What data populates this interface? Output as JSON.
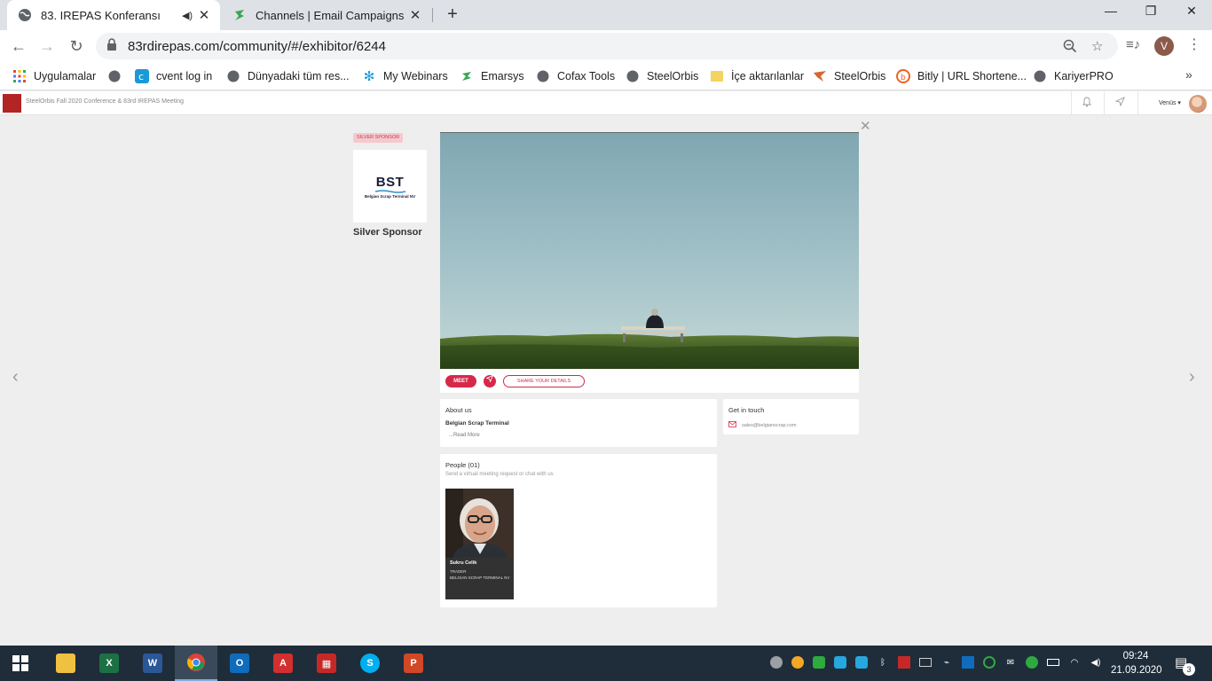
{
  "browser": {
    "tabs": [
      {
        "title": "83. IREPAS Konferansı",
        "active": true
      },
      {
        "title": "Channels | Email Campaigns",
        "active": false
      }
    ],
    "new_tab": "+",
    "url": "83rdirepas.com/community/#/exhibitor/6244",
    "profile_initial": "V",
    "bookmarks": [
      "Uygulamalar",
      "cvent log in",
      "Dünyadaki tüm res...",
      "My Webinars",
      "Emarsys",
      "Cofax Tools",
      "SteelOrbis",
      "İçe aktarılanlar",
      "SteelOrbis",
      "Bitly | URL Shortene...",
      "KariyerPRO"
    ],
    "bookmarks_more": "»"
  },
  "site": {
    "title": "SteelOrbis Fall 2020 Conference & 83rd IREPAS Meeting",
    "user_name": "Venüs"
  },
  "exhibitor": {
    "badge": "SILVER SPONSOR",
    "logo_text": "BST",
    "logo_subtext": "Belgian Scrap Terminal NV",
    "sponsor_label": "Silver Sponsor",
    "meet_label": "MEET",
    "share_label": "SHARE YOUR DETAILS",
    "about_title": "About us",
    "about_name": "Belgian Scrap Terminal",
    "read_more": "...Read More",
    "contact_title": "Get in touch",
    "email": "sales@belgianscrap.com",
    "people_title": "People (01)",
    "people_subtitle": "Send a virtual meeting request or chat with us",
    "person": {
      "name": "Sukru Celik",
      "role": "TRADER",
      "company": "BELGIAN SCRAP TERMINAL NV"
    }
  },
  "taskbar": {
    "time": "09:24",
    "date": "21.09.2020",
    "notification_count": "3"
  },
  "colors": {
    "accent": "#d6294a",
    "tab_bar": "#dee1e6",
    "taskbar": "#1f2d3a",
    "page_bg": "#eeeeee"
  }
}
